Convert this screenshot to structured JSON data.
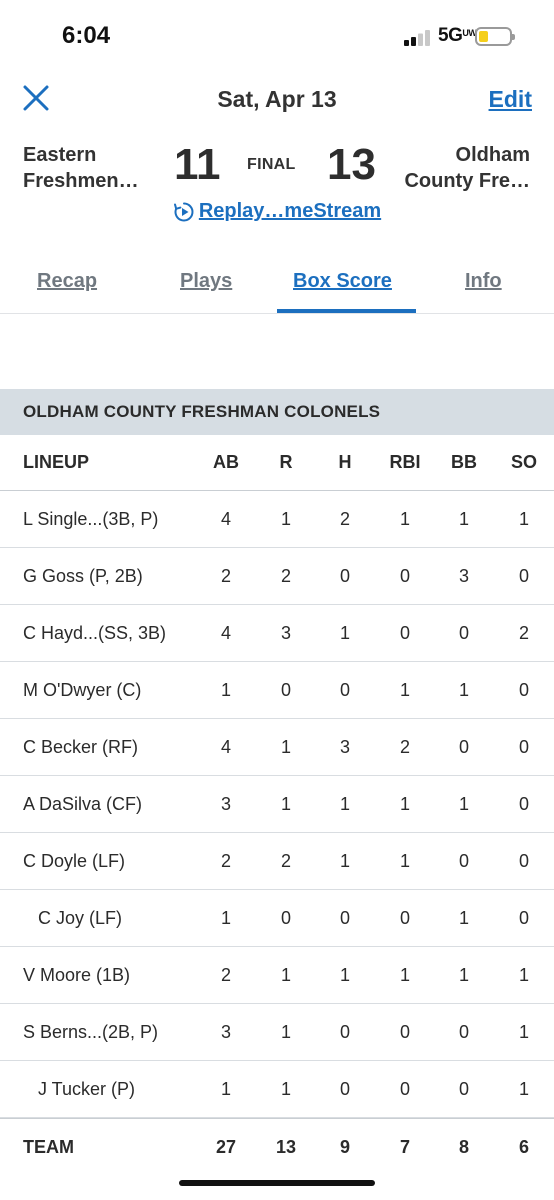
{
  "status": {
    "time": "6:04",
    "network": "5G",
    "network_sup": "UW",
    "battery_level": 0.3,
    "battery_color": "#f5cf1c"
  },
  "nav": {
    "title": "Sat, Apr 13",
    "edit": "Edit",
    "close_icon": "close-icon"
  },
  "game": {
    "home_line1": "Eastern",
    "home_line2": "Freshmen…",
    "home_score": "11",
    "status": "FINAL",
    "away_score": "13",
    "away_line1": "Oldham",
    "away_line2": "County Fre…",
    "replay_label": "Replay…meStream"
  },
  "tabs": [
    "Recap",
    "Plays",
    "Box Score",
    "Info"
  ],
  "active_tab": "Box Score",
  "accent_color": "#1c6fbf",
  "box": {
    "team_name": "OLDHAM COUNTY FRESHMAN COLONELS",
    "columns": [
      "LINEUP",
      "AB",
      "R",
      "H",
      "RBI",
      "BB",
      "SO"
    ],
    "players": [
      {
        "name": "L Single...(3B, P)",
        "ab": "4",
        "r": "1",
        "h": "2",
        "rbi": "1",
        "bb": "1",
        "so": "1"
      },
      {
        "name": "G Goss (P, 2B)",
        "ab": "2",
        "r": "2",
        "h": "0",
        "rbi": "0",
        "bb": "3",
        "so": "0"
      },
      {
        "name": "C Hayd...(SS, 3B)",
        "ab": "4",
        "r": "3",
        "h": "1",
        "rbi": "0",
        "bb": "0",
        "so": "2"
      },
      {
        "name": "M O'Dwyer (C)",
        "ab": "1",
        "r": "0",
        "h": "0",
        "rbi": "1",
        "bb": "1",
        "so": "0"
      },
      {
        "name": "C Becker (RF)",
        "ab": "4",
        "r": "1",
        "h": "3",
        "rbi": "2",
        "bb": "0",
        "so": "0"
      },
      {
        "name": "A DaSilva (CF)",
        "ab": "3",
        "r": "1",
        "h": "1",
        "rbi": "1",
        "bb": "1",
        "so": "0"
      },
      {
        "name": "C Doyle (LF)",
        "ab": "2",
        "r": "2",
        "h": "1",
        "rbi": "1",
        "bb": "0",
        "so": "0"
      },
      {
        "name": "C Joy (LF)",
        "ab": "1",
        "r": "0",
        "h": "0",
        "rbi": "0",
        "bb": "1",
        "so": "0",
        "sub": true
      },
      {
        "name": "V Moore (1B)",
        "ab": "2",
        "r": "1",
        "h": "1",
        "rbi": "1",
        "bb": "1",
        "so": "1"
      },
      {
        "name": "S Berns...(2B, P)",
        "ab": "3",
        "r": "1",
        "h": "0",
        "rbi": "0",
        "bb": "0",
        "so": "1"
      },
      {
        "name": "J Tucker (P)",
        "ab": "1",
        "r": "1",
        "h": "0",
        "rbi": "0",
        "bb": "0",
        "so": "1",
        "sub": true
      }
    ],
    "team": {
      "name": "TEAM",
      "ab": "27",
      "r": "13",
      "h": "9",
      "rbi": "7",
      "bb": "8",
      "so": "6"
    }
  }
}
